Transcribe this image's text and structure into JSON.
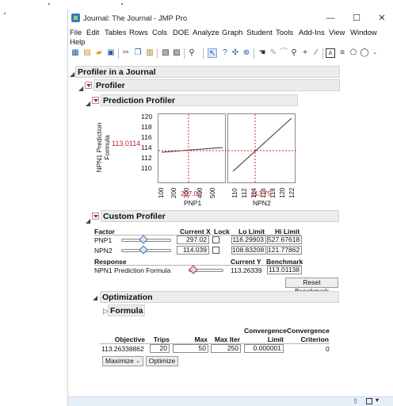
{
  "window": {
    "title": "Journal: The Journal - JMP Pro",
    "controls": [
      "—",
      "☐",
      "✕"
    ]
  },
  "menu": [
    "File",
    "Edit",
    "Tables",
    "Rows",
    "Cols",
    "DOE",
    "Analyze",
    "Graph",
    "Student",
    "Tools",
    "Add-Ins",
    "View",
    "Window",
    "Help"
  ],
  "report": {
    "outline_title": "Profiler in a Journal",
    "profiler_title": "Profiler",
    "prediction_profiler_title": "Prediction Profiler",
    "y_axis_label_line1": "NPN1 Prediction",
    "y_axis_label_line2": "Formula",
    "y_current": "113.0114",
    "y_ticks": [
      "120",
      "118",
      "116",
      "114",
      "112",
      "110"
    ],
    "panel1": {
      "x_ticks": [
        "100",
        "200",
        "300",
        "400",
        "500"
      ],
      "x_current": "297.02",
      "x_label": "PNP1"
    },
    "panel2": {
      "x_ticks": [
        "110",
        "112",
        "114",
        "116",
        "118",
        "120",
        "122"
      ],
      "x_current": "113.75",
      "x_label": "NPN2"
    },
    "custom_profiler_title": "Custom Profiler",
    "factor_headers": [
      "Factor",
      "Current X",
      "Lock",
      "Lo Limit",
      "Hi Limit"
    ],
    "factors": [
      {
        "name": "PNP1",
        "current_x": "297.02",
        "lo": "116.29903",
        "hi": "527.67618",
        "knob": 0.44
      },
      {
        "name": "NPN2",
        "current_x": "114.039",
        "lo": "108.83208",
        "hi": "121.77862",
        "knob": 0.44
      }
    ],
    "response_headers": [
      "Response",
      "Current Y",
      "Benchmark"
    ],
    "response": {
      "name": "NPN1 Prediction Formula",
      "current_y": "113.26339",
      "benchmark": "113.01138",
      "knob": 0.42
    },
    "reset_benchmark_label": "Reset Benchmark",
    "optimization_title": "Optimization",
    "formula_title": "Formula",
    "opt_headers": {
      "objective": "Objective",
      "trips": "Trips",
      "max_cycles": "Max Cycles",
      "max_iter": "Max Iter",
      "conv_limit_1": "Convergence",
      "conv_limit_2": "Limit",
      "conv_crit_1": "Convergence",
      "conv_crit_2": "Criterion"
    },
    "opt_values": {
      "objective": "113.26338862",
      "trips": "20",
      "max_cycles": "50",
      "max_iter": "250",
      "conv_limit": "0.000001",
      "conv_crit": "0"
    },
    "maximize_label": "Maximize",
    "optimize_label": "Optimize"
  },
  "colors": {
    "accent_red": "#c8202a",
    "header_bg": "#ececec",
    "status_bg": "#e6eef8"
  },
  "icons": [
    "new-table-icon",
    "open-icon",
    "save-icon",
    "cut-icon",
    "copy-icon",
    "paste-icon",
    "journal-icon",
    "search-icon",
    "arrow-icon",
    "help-icon",
    "crosshair-icon",
    "hand-icon",
    "zoom-icon",
    "plus-icon",
    "line-icon",
    "text-icon",
    "shape-icon"
  ]
}
